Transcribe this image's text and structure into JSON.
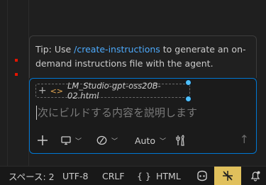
{
  "chat": {
    "tip": {
      "prefix": "Tip: Use ",
      "link": "/create-instructions",
      "suffix": " to generate an on-demand instructions file with the agent."
    },
    "context_file": {
      "add_icon": "+",
      "file_icon": "<>",
      "name": "LM_Studio-gpt-oss20B-02.html"
    },
    "input": {
      "placeholder": "次にビルドする内容を説明します"
    },
    "toolbar": {
      "add_icon": "plus-icon",
      "device_icon": "monitor-icon",
      "mode_icon": "agent-mode-icon",
      "model_label": "Auto",
      "tools_icon": "tools-icon",
      "send_icon": "arrow-up-icon"
    }
  },
  "statusbar": {
    "indent": "スペース: 2",
    "encoding": "UTF-8",
    "eol": "CRLF",
    "language_brackets": "{ }",
    "language": "HTML",
    "copilot_icon": "copilot-icon",
    "debug_icon": "no-debug-icon",
    "notifications_icon": "bell-icon"
  },
  "colors": {
    "accent": "#0078d4",
    "link": "#4daafc",
    "status_highlight": "#e0c05c",
    "error_marker": "#e51400"
  }
}
